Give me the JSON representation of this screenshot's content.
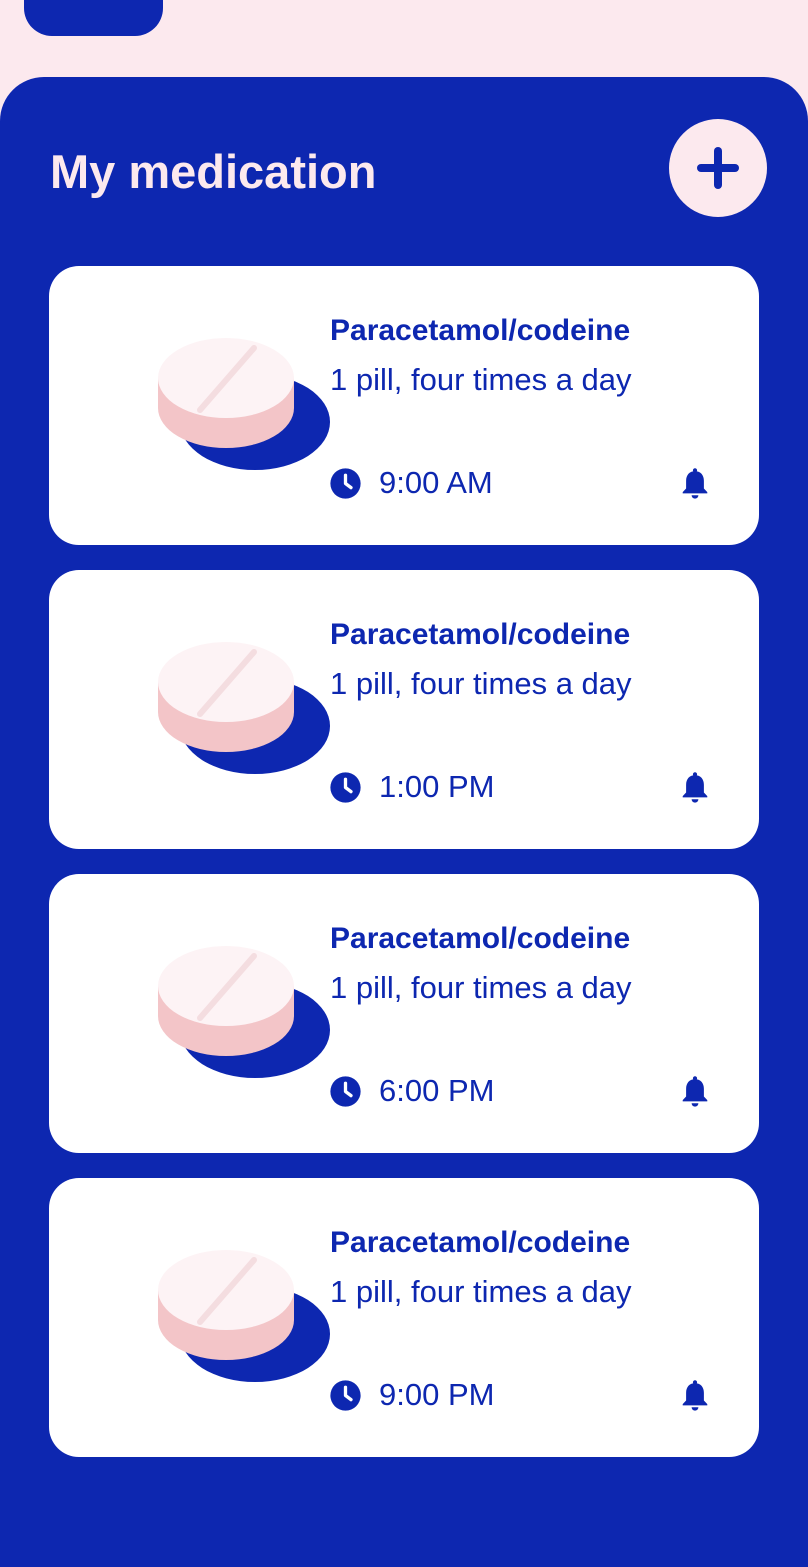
{
  "header": {
    "title": "My medication",
    "add_icon": "plus-icon"
  },
  "colors": {
    "primary": "#0d27b0",
    "background": "#fce9ee",
    "card": "#ffffff",
    "pill_face": "#fdf3f5",
    "pill_side": "#f3c5c8"
  },
  "medications": [
    {
      "name": "Paracetamol/codeine",
      "dose": "1 pill, four times a day",
      "time": "9:00 AM",
      "icon": "pill-icon",
      "time_icon": "clock-icon",
      "reminder_icon": "bell-icon"
    },
    {
      "name": "Paracetamol/codeine",
      "dose": "1 pill, four times a day",
      "time": "1:00 PM",
      "icon": "pill-icon",
      "time_icon": "clock-icon",
      "reminder_icon": "bell-icon"
    },
    {
      "name": "Paracetamol/codeine",
      "dose": "1 pill, four times a day",
      "time": "6:00 PM",
      "icon": "pill-icon",
      "time_icon": "clock-icon",
      "reminder_icon": "bell-icon"
    },
    {
      "name": "Paracetamol/codeine",
      "dose": "1 pill, four times a day",
      "time": "9:00 PM",
      "icon": "pill-icon",
      "time_icon": "clock-icon",
      "reminder_icon": "bell-icon"
    }
  ]
}
